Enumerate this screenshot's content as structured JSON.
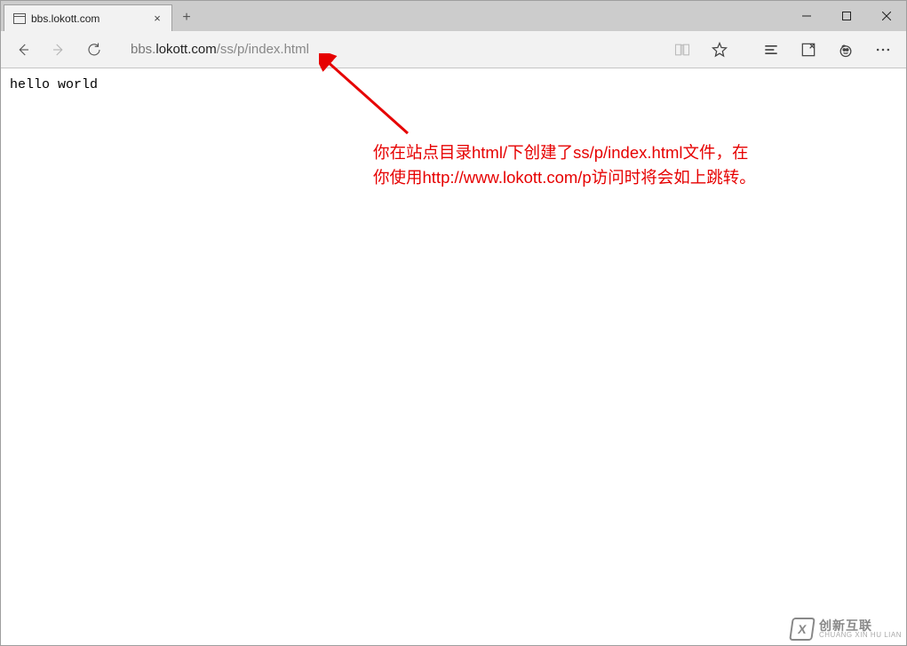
{
  "tab": {
    "title": "bbs.lokott.com"
  },
  "url": {
    "prefix": "bbs.",
    "host": "lokott.com",
    "path": "/ss/p/index.html"
  },
  "page": {
    "body_text": "hello world"
  },
  "annotation": {
    "text": "你在站点目录html/下创建了ss/p/index.html文件，在你使用http://www.lokott.com/p访问时将会如上跳转。"
  },
  "watermark": {
    "logo_letter": "X",
    "main": "创新互联",
    "sub": "CHUANG XIN HU LIAN"
  },
  "icons": {
    "close": "×",
    "plus": "+"
  }
}
